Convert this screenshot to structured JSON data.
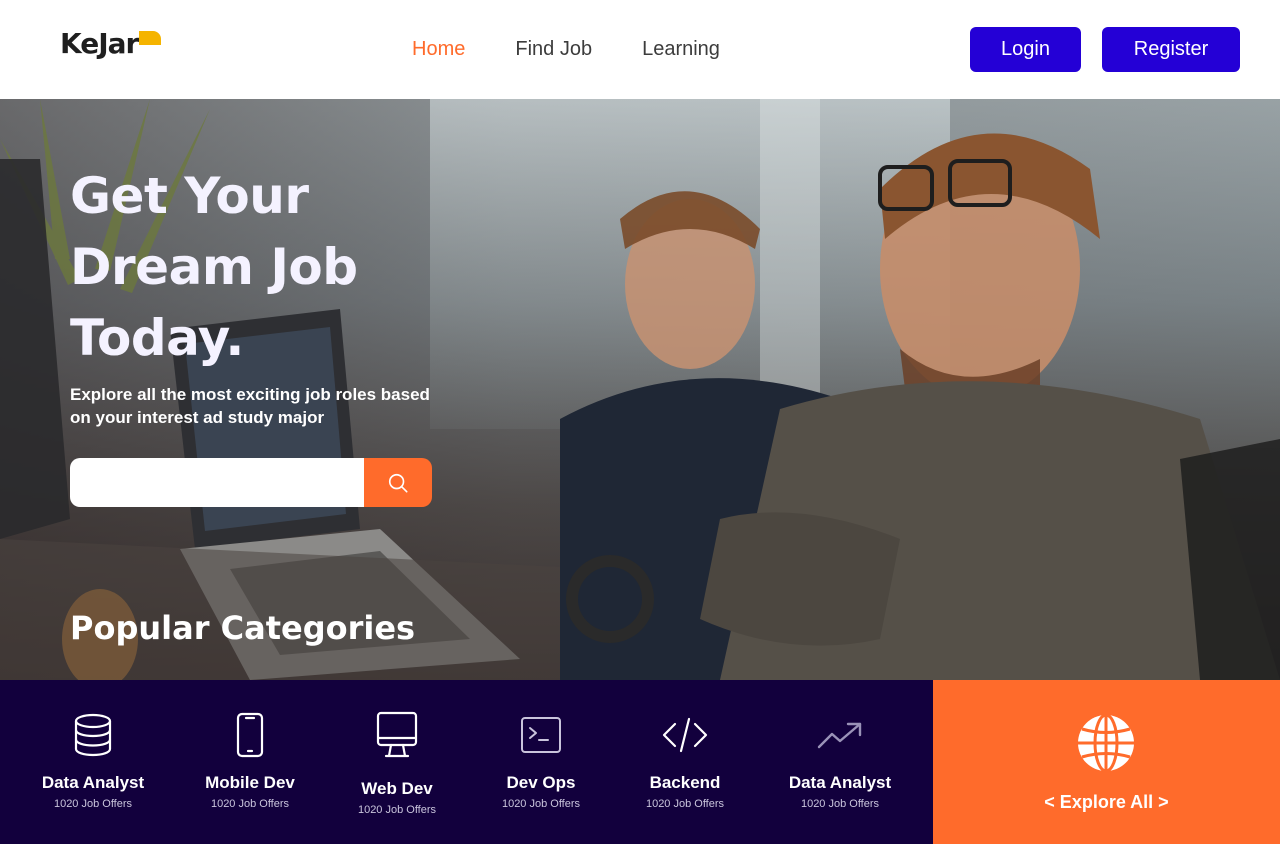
{
  "brand": {
    "name": "KeJar",
    "accent": "#f5b400"
  },
  "nav": {
    "items": [
      {
        "label": "Home",
        "active": true
      },
      {
        "label": "Find Job",
        "active": false
      },
      {
        "label": "Learning",
        "active": false
      }
    ]
  },
  "auth": {
    "login_label": "Login",
    "register_label": "Register"
  },
  "hero": {
    "title_lines": [
      "Get Your",
      "Dream Job",
      "Today."
    ],
    "subtitle": "Explore all the most exciting job roles based on your interest ad study major",
    "search": {
      "placeholder": "",
      "value": "",
      "icon": "search-icon"
    }
  },
  "categories": {
    "title": "Popular Categories",
    "items": [
      {
        "name": "Data Analyst",
        "count": "1020 Job Offers",
        "icon": "database-icon"
      },
      {
        "name": "Mobile Dev",
        "count": "1020 Job Offers",
        "icon": "smartphone-icon"
      },
      {
        "name": "Web Dev",
        "count": "1020 Job Offers",
        "icon": "monitor-icon"
      },
      {
        "name": "Dev Ops",
        "count": "1020 Job Offers",
        "icon": "terminal-icon"
      },
      {
        "name": "Backend",
        "count": "1020 Job Offers",
        "icon": "code-icon"
      },
      {
        "name": "Data Analyst",
        "count": "1020 Job Offers",
        "icon": "trending-up-icon"
      }
    ],
    "explore": {
      "label": "< Explore All >",
      "icon": "globe-icon"
    }
  },
  "colors": {
    "primary": "#2400d6",
    "accent_orange": "#ff6b2b",
    "dark_navy": "#12003d",
    "text_dark": "#3c3c3c"
  }
}
